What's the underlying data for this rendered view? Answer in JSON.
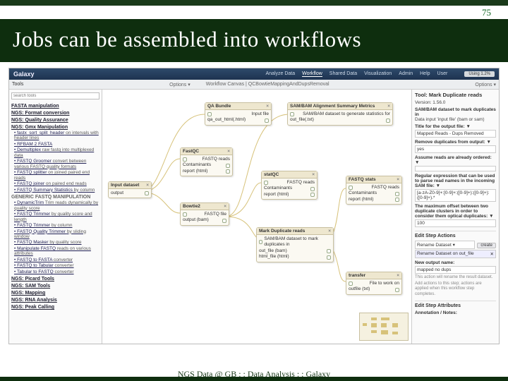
{
  "slide": {
    "page_number": "75",
    "title": "Jobs can be assembled into workflows",
    "footer": "NGS Data @ GB : : Data Analysis : : Galaxy"
  },
  "galaxy": {
    "logo": "Galaxy",
    "nav": [
      "Analyze Data",
      "Workflow",
      "Shared Data",
      "Visualization",
      "Admin",
      "Help",
      "User"
    ],
    "nav_active": "Workflow",
    "using_label": "Using 1.2%",
    "sub_left": "Tools",
    "sub_options": "Options ▾",
    "canvas_crumb": "Workflow Canvas | QCBowtieMappingAndDupsRemoval",
    "canvas_options": "Options ▾"
  },
  "tools": {
    "search_placeholder": "search tools",
    "sections": [
      {
        "name": "FASTA manipulation",
        "items": []
      },
      {
        "name": "NGS: Format conversion",
        "items": []
      },
      {
        "name": "NGS: Quality Assurance",
        "items": []
      },
      {
        "name": "NGS: Gmx Manipulation",
        "items": [
          {
            "label": "fastx_sort_split_header",
            "desc": "on intervals with header lines"
          },
          {
            "label": "RFBAM 2 FASTA",
            "desc": ""
          },
          {
            "label": "Demultiplex",
            "desc": "raw fastq into multiplexed data"
          },
          {
            "label": "FASTQ Groomer",
            "desc": "convert between various FASTQ quality formats"
          },
          {
            "label": "FASTQ splitter",
            "desc": "on joined paired end reads"
          },
          {
            "label": "FASTQ joiner",
            "desc": "on paired end reads"
          },
          {
            "label": "FASTQ Summary Statistics",
            "desc": "by column"
          }
        ]
      },
      {
        "name": "GENERIC FASTQ MANIPULATION",
        "items": [
          {
            "label": "DynamicTrim",
            "desc": "Trim reads dynamically by quality score"
          },
          {
            "label": "FASTQ Trimmer",
            "desc": "by quality score and length"
          },
          {
            "label": "FASTQ Trimmer",
            "desc": "by column"
          },
          {
            "label": "FASTQ Quality Trimmer",
            "desc": "by sliding window"
          },
          {
            "label": "FASTQ Masker",
            "desc": "by quality score"
          },
          {
            "label": "Manipulate FASTQ",
            "desc": "reads on various attributes"
          },
          {
            "label": "FASTQ to FASTA",
            "desc": "converter"
          },
          {
            "label": "FASTQ to Tabular",
            "desc": "converter"
          },
          {
            "label": "Tabular to FASTQ",
            "desc": "converter"
          }
        ]
      },
      {
        "name": "NGS: Picard Tools",
        "items": []
      },
      {
        "name": "NGS: SAM Tools",
        "items": []
      },
      {
        "name": "NGS: Mapping",
        "items": []
      },
      {
        "name": "NGS: RNA Analysis",
        "items": []
      },
      {
        "name": "NGS: Peak Calling",
        "items": []
      }
    ]
  },
  "nodes": {
    "input": {
      "title": "Input dataset",
      "out": "output"
    },
    "qabundle": {
      "title": "QA Bundle",
      "in": "Input file",
      "out": "qa_out_html(.html)"
    },
    "fastqc1": {
      "title": "FastQC",
      "in": "FASTQ reads",
      "o1": "Contaminants",
      "o2": "report (html)"
    },
    "bowtie": {
      "title": "Bowtie2",
      "in": "FASTQ file",
      "out": "output (bam)"
    },
    "samsum": {
      "title": "SAM/BAM Alignment Summary Metrics",
      "in": "SAM/BAM dataset to generate statistics for",
      "out": "out_file(.txt)"
    },
    "stats": {
      "title": "statQC",
      "in": "FASTQ reads",
      "o1": "Contaminants",
      "o2": "report (html)"
    },
    "markdup": {
      "title": "Mark Duplicate reads",
      "in": "SAM/BAM dataset to mark duplicates in",
      "o1": "out_file (bam)",
      "o2": "html_file (html)"
    },
    "fqstats": {
      "title": "FASTQ stats",
      "in": "FASTQ reads",
      "o1": "Contaminants",
      "o2": "report (html)"
    },
    "transfer": {
      "title": "transfer",
      "in": "File to work on",
      "out": "outfile (txt)"
    }
  },
  "right": {
    "title": "Tool: Mark Duplicate reads",
    "version": "Version: 1.56.0",
    "desc": "SAM/BAM dataset to mark duplicates in",
    "desc2": "Data input 'input file' (bam or sam)",
    "field1_label": "Title for the output file: ▼",
    "field1_value": "Mapped Reads - Dups Removed",
    "field2_label": "Remove duplicates from output: ▼",
    "field2_value": "yes",
    "field3_label": "Assume reads are already ordered: ▼",
    "field3_value": "",
    "field4_label": "Regular expression that can be used to parse read names in the incoming SAM file: ▼",
    "field4_value": "[a-zA-Z0-9]+:[0-9]+:([0-9]+):([0-9]+):([0-9]+).*",
    "field5_label": "The maximum offset between two duplicate clusters in order to consider them optical duplicates: ▼",
    "field5_value": "100",
    "actions_title": "Edit Step Actions",
    "action_sel": "Rename Dataset ▾",
    "action_btn": "create",
    "action_row": "Rename Dataset on out_file",
    "action_row_x": "✕",
    "newname_label": "New output name:",
    "newname_value": "mapped no dups",
    "hint1": "This action will rename the result dataset.",
    "hint2": "Add actions to this step; actions are applied when this workflow step completes.",
    "attrs": "Edit Step Attributes",
    "annot": "Annotation / Notes:"
  }
}
